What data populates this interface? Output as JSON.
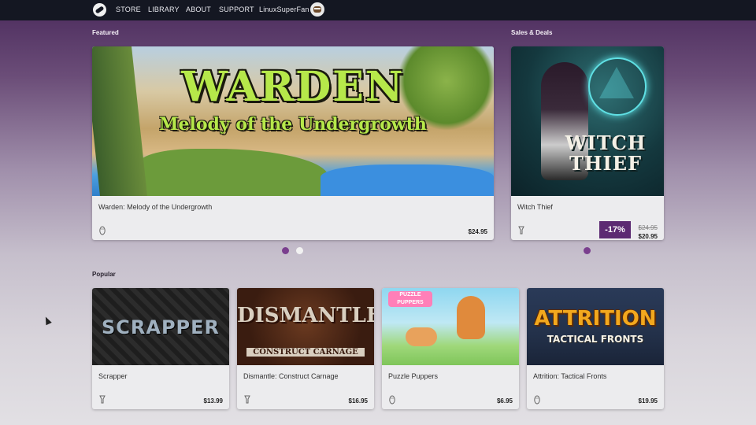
{
  "nav": {
    "items": [
      "STORE",
      "LIBRARY",
      "ABOUT",
      "SUPPORT",
      "LinuxSuperFan"
    ]
  },
  "sections": {
    "featured": "Featured",
    "sales": "Sales & Deals",
    "popular": "Popular"
  },
  "featured": {
    "logo_line1": "WARDEN",
    "logo_line2": "Melody of the Undergrowth",
    "title": "Warden: Melody of the Undergrowth",
    "price": "$24.95",
    "platform_icon": "linux-penguin-icon"
  },
  "sale": {
    "logo_line1": "WITCH",
    "logo_line2": "THIEF",
    "title": "Witch Thief",
    "discount": "-17%",
    "old_price": "$24.95",
    "new_price": "$20.95",
    "platform_icon": "steam-pipe-icon"
  },
  "popular": [
    {
      "art_text": "SCRAPPER",
      "title": "Scrapper",
      "price": "$13.99",
      "platform_icon": "steam-pipe-icon"
    },
    {
      "art_text": "DISMANTLE",
      "art_sub": "CONSTRUCT CARNAGE",
      "title": "Dismantle: Construct Carnage",
      "price": "$16.95",
      "platform_icon": "steam-pipe-icon"
    },
    {
      "art_text": "PUZZLE PUPPERS",
      "title": "Puzzle Puppers",
      "price": "$6.95",
      "platform_icon": "linux-penguin-icon"
    },
    {
      "art_text": "ATTRITION",
      "art_sub": "TACTICAL FRONTS",
      "title": "Attrition: Tactical Fronts",
      "price": "$19.95",
      "platform_icon": "linux-penguin-icon"
    }
  ],
  "colors": {
    "topbar": "#141722",
    "accent": "#5c2a72",
    "dot_active": "#7a3f8e",
    "dot_inactive": "#f2f2f2"
  }
}
